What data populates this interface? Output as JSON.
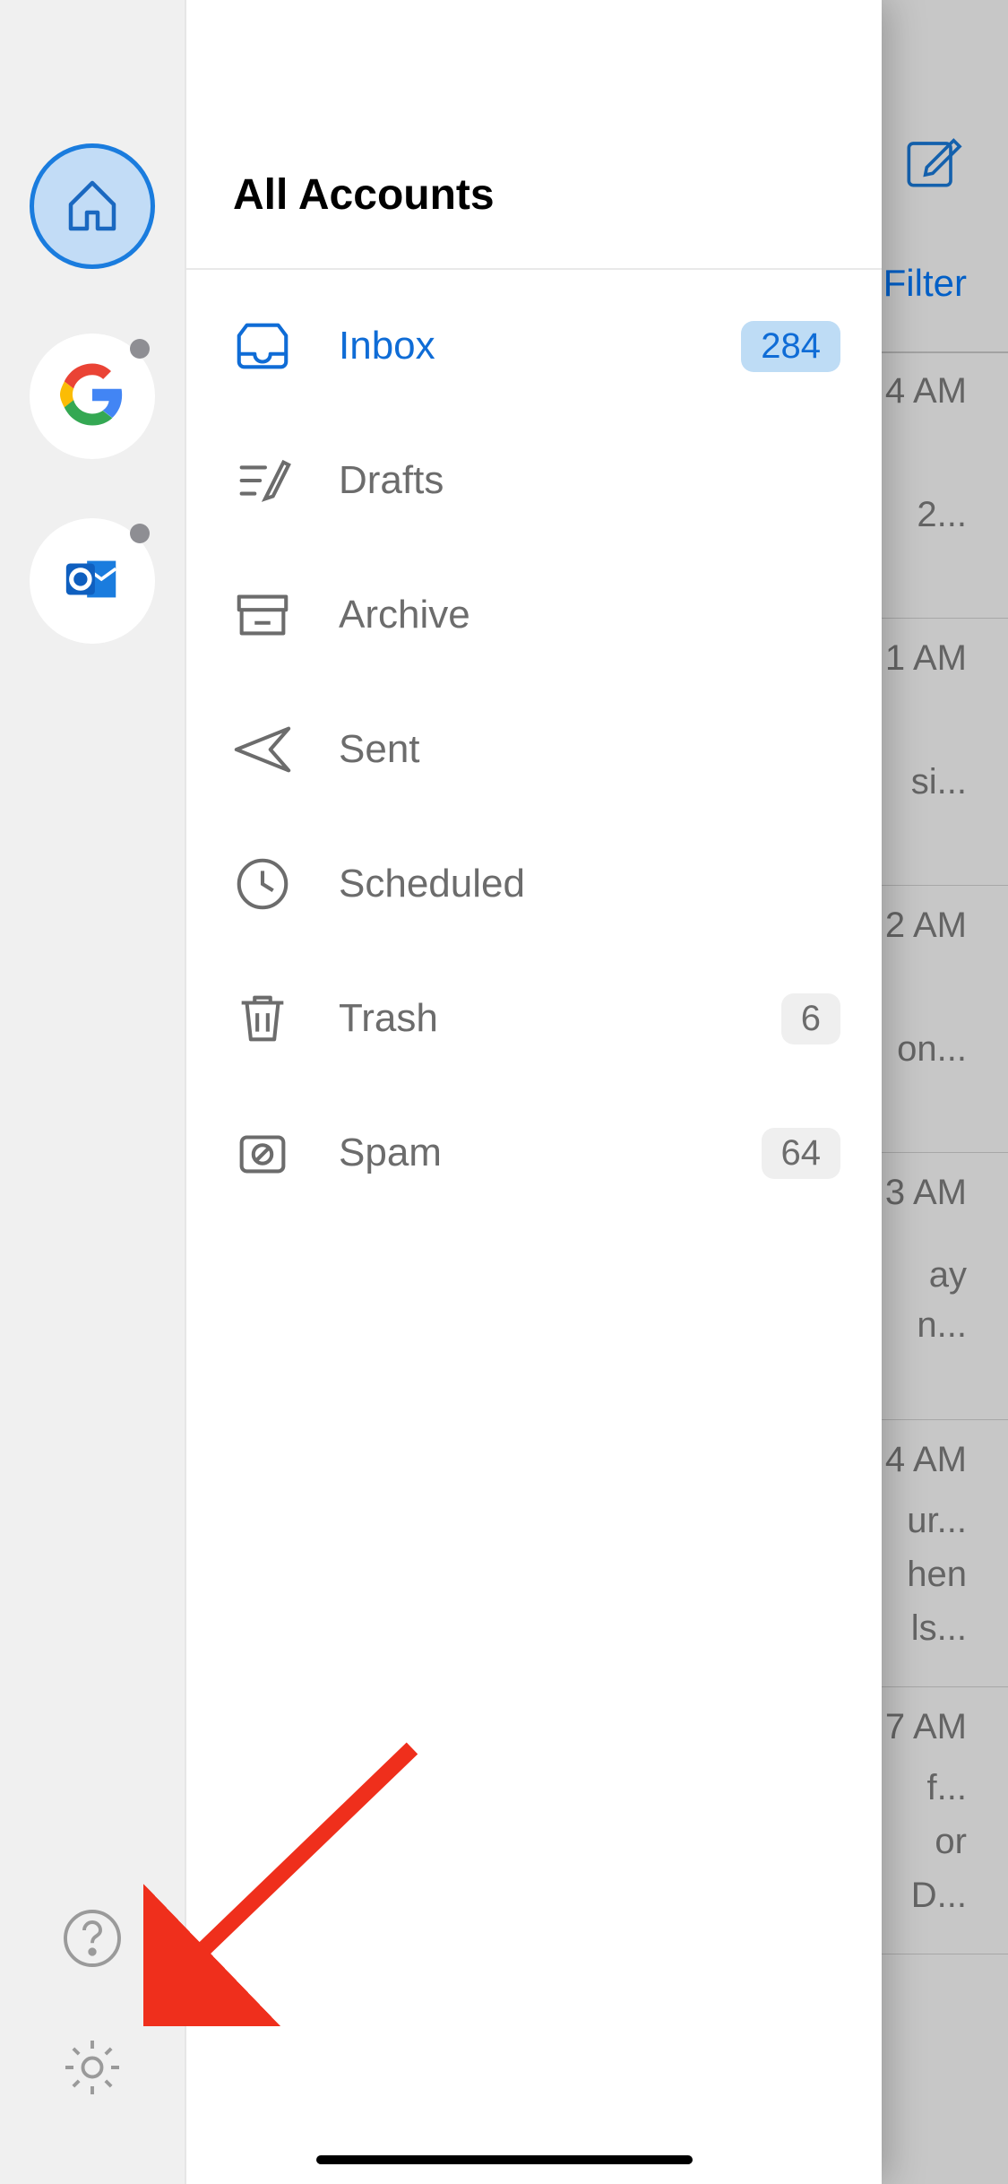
{
  "background": {
    "filter_label": "Filter",
    "rows": [
      {
        "time": "4 AM",
        "snips": [
          "2..."
        ]
      },
      {
        "time": "1 AM",
        "snips": [
          "si..."
        ]
      },
      {
        "time": "2 AM",
        "snips": [
          "on..."
        ]
      },
      {
        "time": "3 AM",
        "snips": [
          "ay",
          "n..."
        ]
      },
      {
        "time": "4 AM",
        "snips": [
          "ur...",
          "hen",
          "ls..."
        ]
      },
      {
        "time": "7 AM",
        "snips": [
          "f...",
          "or",
          "D..."
        ]
      }
    ]
  },
  "drawer": {
    "title": "All Accounts",
    "accounts": {
      "home": "home",
      "google": "google",
      "outlook": "outlook"
    },
    "folders": [
      {
        "id": "inbox",
        "label": "Inbox",
        "count": "284",
        "active": true
      },
      {
        "id": "drafts",
        "label": "Drafts",
        "count": "",
        "active": false
      },
      {
        "id": "archive",
        "label": "Archive",
        "count": "",
        "active": false
      },
      {
        "id": "sent",
        "label": "Sent",
        "count": "",
        "active": false
      },
      {
        "id": "scheduled",
        "label": "Scheduled",
        "count": "",
        "active": false
      },
      {
        "id": "trash",
        "label": "Trash",
        "count": "6",
        "active": false
      },
      {
        "id": "spam",
        "label": "Spam",
        "count": "64",
        "active": false
      }
    ],
    "rail_bottom": {
      "help": "help",
      "settings": "settings"
    }
  },
  "colors": {
    "accent": "#0f6cd6",
    "rail_bg": "#f0f0f0",
    "muted": "#6c6c6c",
    "arrow": "#ef2f1c"
  }
}
